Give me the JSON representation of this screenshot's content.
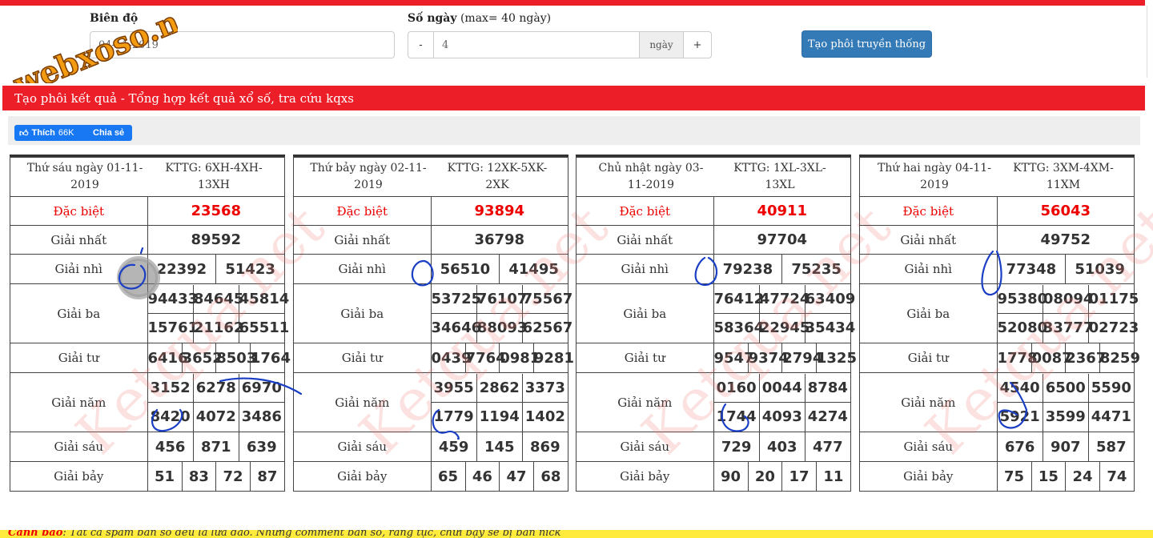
{
  "form": {
    "bien_do_label": "Biên độ",
    "date_value": "04-11-2019",
    "so_ngay_label": "Số ngày",
    "so_ngay_hint": "(max= 40 ngày)",
    "minus_label": "-",
    "days_value": "4",
    "days_unit": "ngày",
    "plus_label": "+",
    "submit_label": "Tạo phôi truyền thống"
  },
  "logo_text": "webxoso.net",
  "banner_title": "Tạo phôi kết quả - Tổng hợp kết quả xổ số, tra cứu kqxs",
  "social": {
    "like_label": "Thích",
    "like_count": "66K",
    "share_label": "Chia sẻ"
  },
  "labels": {
    "db": "Đặc biệt",
    "g1": "Giải nhất",
    "g2": "Giải nhì",
    "g3": "Giải ba",
    "g4": "Giải tư",
    "g5": "Giải năm",
    "g6": "Giải sáu",
    "g7": "Giải bảy"
  },
  "watermark": "Ketqua.net",
  "boards": [
    {
      "day": "Thứ sáu ngày 01-11-2019",
      "kttg": "KTTG: 6XH-4XH-13XH",
      "db": "23568",
      "g1": "89592",
      "g2": [
        "22392",
        "51423"
      ],
      "g3": [
        "94433",
        "84645",
        "45814",
        "15761",
        "21162",
        "65511"
      ],
      "g4": [
        "6416",
        "3652",
        "8503",
        "1764"
      ],
      "g5": [
        "3152",
        "6278",
        "6970",
        "8420",
        "4072",
        "3486"
      ],
      "g6": [
        "456",
        "871",
        "639"
      ],
      "g7": [
        "51",
        "83",
        "72",
        "87"
      ]
    },
    {
      "day": "Thứ bảy ngày 02-11-2019",
      "kttg": "KTTG: 12XK-5XK-2XK",
      "db": "93894",
      "g1": "36798",
      "g2": [
        "56510",
        "41495"
      ],
      "g3": [
        "53725",
        "76107",
        "75567",
        "34646",
        "88093",
        "62567"
      ],
      "g4": [
        "0439",
        "7764",
        "0981",
        "9281"
      ],
      "g5": [
        "3955",
        "2862",
        "3373",
        "1779",
        "1194",
        "1402"
      ],
      "g6": [
        "459",
        "145",
        "869"
      ],
      "g7": [
        "65",
        "46",
        "47",
        "68"
      ]
    },
    {
      "day": "Chủ nhật ngày 03-11-2019",
      "kttg": "KTTG: 1XL-3XL-13XL",
      "db": "40911",
      "g1": "97704",
      "g2": [
        "79238",
        "75235"
      ],
      "g3": [
        "76412",
        "47724",
        "63409",
        "58364",
        "22945",
        "35434"
      ],
      "g4": [
        "9547",
        "9374",
        "2794",
        "1325"
      ],
      "g5": [
        "0160",
        "0044",
        "8784",
        "1744",
        "4093",
        "4274"
      ],
      "g6": [
        "729",
        "403",
        "477"
      ],
      "g7": [
        "90",
        "20",
        "17",
        "11"
      ]
    },
    {
      "day": "Thứ hai ngày 04-11-2019",
      "kttg": "KTTG: 3XM-4XM-11XM",
      "db": "56043",
      "g1": "49752",
      "g2": [
        "77348",
        "51039"
      ],
      "g3": [
        "95380",
        "08094",
        "01175",
        "52080",
        "33777",
        "02723"
      ],
      "g4": [
        "1778",
        "0087",
        "2367",
        "8259"
      ],
      "g5": [
        "4540",
        "6500",
        "5590",
        "5921",
        "3599",
        "4471"
      ],
      "g6": [
        "676",
        "907",
        "587"
      ],
      "g7": [
        "75",
        "15",
        "24",
        "74"
      ]
    }
  ],
  "warning": {
    "label": "Cảnh báo",
    "text": ": Tất cả spam bán số đều là lừa đảo. Những comment bán số, rằng tục, chửi bậy sẽ bị ban nick"
  },
  "colors": {
    "brand_red": "#ec1e28",
    "primary_blue": "#337ab7",
    "facebook_blue": "#1877f2",
    "warning_yellow": "#ffeb3b"
  }
}
